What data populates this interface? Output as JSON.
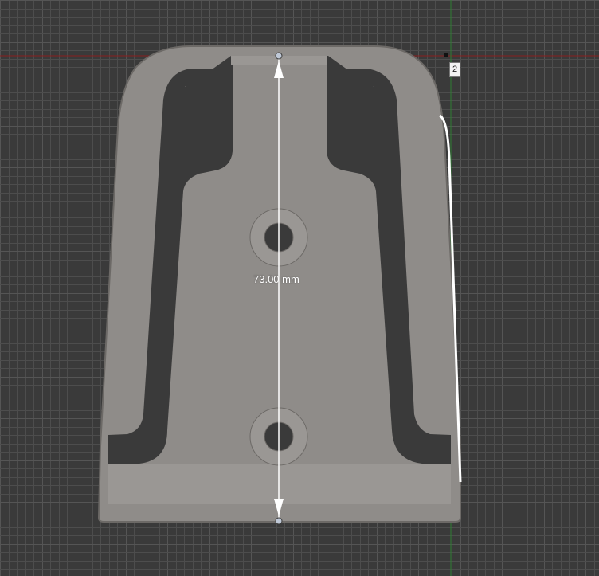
{
  "viewport": {
    "background_color": "#3a3a3a",
    "grid_color": "#4d4d4d",
    "grid_major_color": "#555555",
    "axis_x_color": "#8b1e1e",
    "axis_y_color": "#2e7d32"
  },
  "part": {
    "body_color": "#8f8c89",
    "edge_color": "#6c6966",
    "inner_color": "#9a9794"
  },
  "dimension": {
    "label": "73.00 mm",
    "line_color": "#ffffff"
  },
  "vertex_marker": {
    "label": "2"
  }
}
